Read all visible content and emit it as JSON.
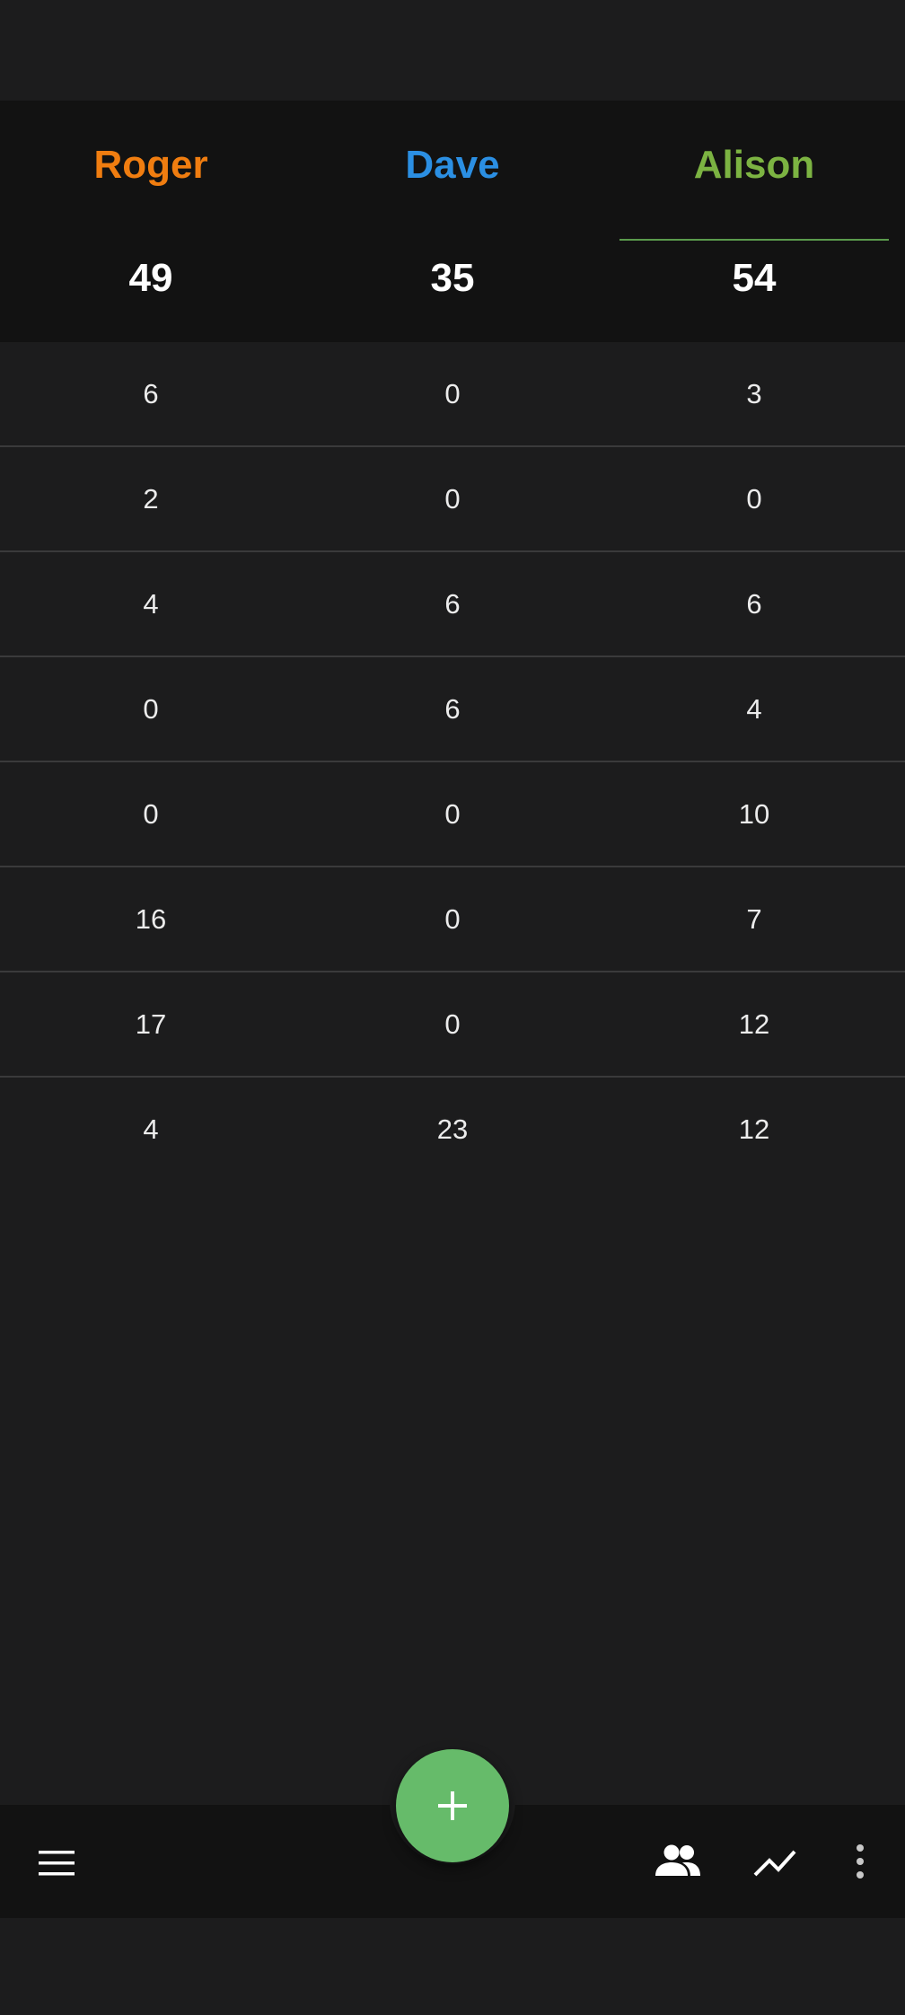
{
  "players": [
    {
      "name": "Roger",
      "total": "49",
      "color": "#f07d10"
    },
    {
      "name": "Dave",
      "total": "35",
      "color": "#2b8fe3"
    },
    {
      "name": "Alison",
      "total": "54",
      "color": "#7cb342"
    }
  ],
  "leader_color": "#5a9a4c",
  "rounds": [
    [
      "6",
      "0",
      "3"
    ],
    [
      "2",
      "0",
      "0"
    ],
    [
      "4",
      "6",
      "6"
    ],
    [
      "0",
      "6",
      "4"
    ],
    [
      "0",
      "0",
      "10"
    ],
    [
      "16",
      "0",
      "7"
    ],
    [
      "17",
      "0",
      "12"
    ],
    [
      "4",
      "23",
      "12"
    ]
  ],
  "fab": {
    "icon": "plus-icon",
    "color": "#66bb6a"
  },
  "bottom_bar": {
    "icons": [
      "menu-icon",
      "people-icon",
      "trending-up-icon",
      "more-vertical-icon"
    ]
  }
}
